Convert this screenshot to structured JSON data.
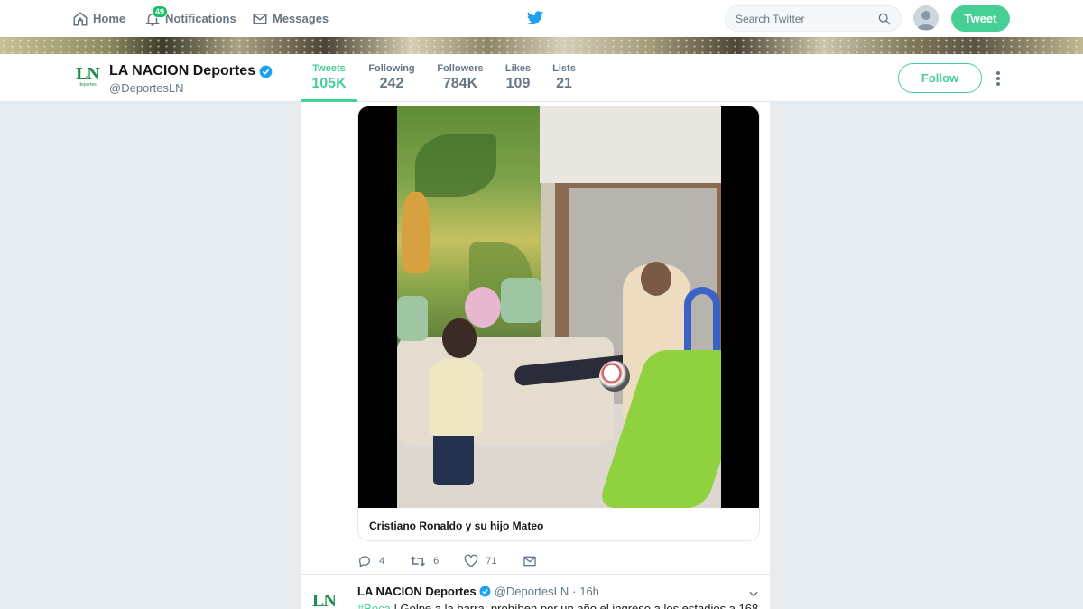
{
  "nav": {
    "home_label": "Home",
    "notifications_label": "Notifications",
    "notifications_count": "49",
    "messages_label": "Messages",
    "search_placeholder": "Search Twitter",
    "tweet_button": "Tweet"
  },
  "colors": {
    "accent": "#45cf95",
    "brand_green": "#1e8d4e",
    "verified": "#1da1f2",
    "twitter_blue": "#1da1f2"
  },
  "profile": {
    "logo_text": "LN",
    "logo_sub": "deportes",
    "name": "LA NACION Deportes",
    "handle": "@DeportesLN",
    "follow_label": "Follow",
    "stats": [
      {
        "label": "Tweets",
        "value": "105K"
      },
      {
        "label": "Following",
        "value": "242"
      },
      {
        "label": "Followers",
        "value": "784K"
      },
      {
        "label": "Likes",
        "value": "109"
      },
      {
        "label": "Lists",
        "value": "21"
      }
    ]
  },
  "tweet1": {
    "card_title": "Cristiano Ronaldo y su hijo Mateo",
    "replies": "4",
    "retweets": "6",
    "likes": "71"
  },
  "tweet2": {
    "logo_text": "LN",
    "name": "LA NACION Deportes",
    "handle": "@DeportesLN",
    "time": "· 16h",
    "hashtag": "#Boca",
    "text": " | Golpe a la barra: prohíben por un año el ingreso a los estadios a 168"
  },
  "icons": [
    "home-icon",
    "bell-icon",
    "envelope-icon",
    "twitter-bird-icon",
    "search-icon",
    "verified-icon",
    "reply-icon",
    "retweet-icon",
    "heart-icon",
    "direct-message-icon",
    "chevron-down-icon",
    "more-icon"
  ]
}
